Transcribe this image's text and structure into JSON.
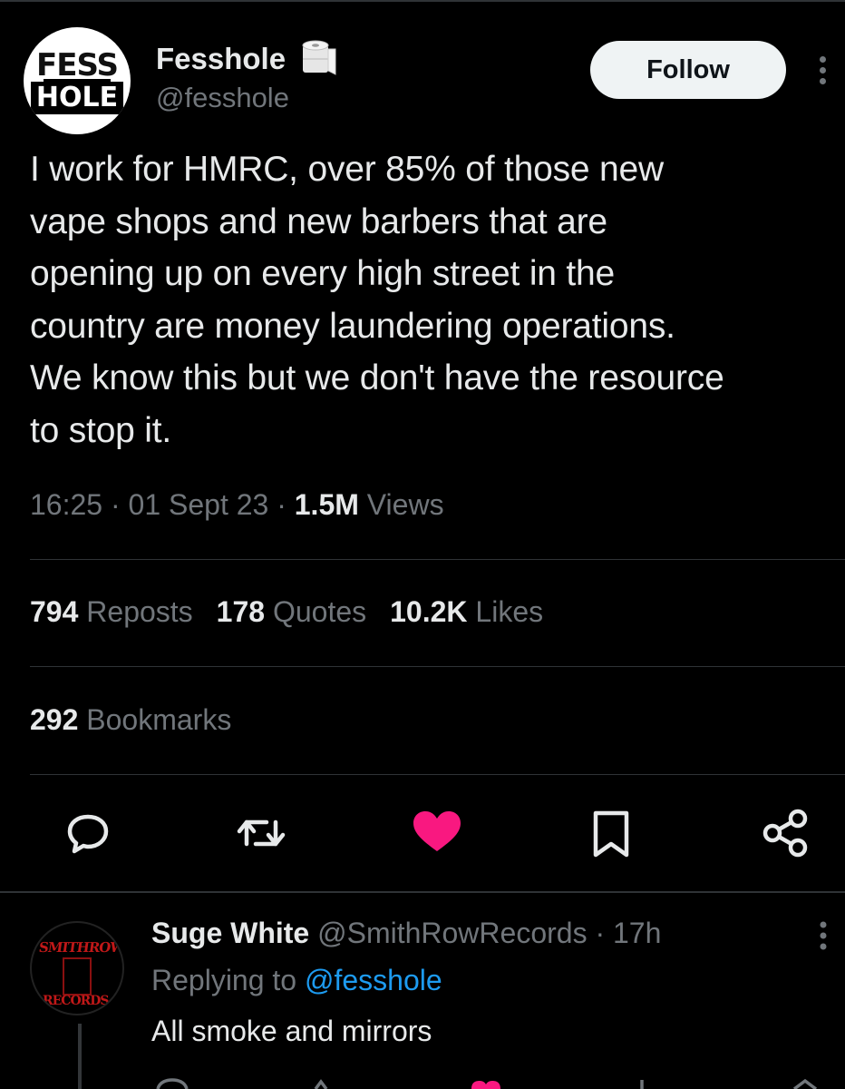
{
  "tweet": {
    "author_name": "Fesshole",
    "author_handle": "@fesshole",
    "avatar": {
      "line1": "FESS",
      "line2": "HOLE"
    },
    "badge_icon": "toilet-paper-icon",
    "follow_label": "Follow",
    "text": "I work for HMRC, over 85% of those new\nvape shops and new barbers that are\nopening up on every high street in the\ncountry are money laundering operations.\nWe know this but we don't have the resource\nto stop it.",
    "time": "16:25",
    "date": "01 Sept 23",
    "views_count": "1.5M",
    "views_label": "Views",
    "stats": {
      "reposts_count": "794",
      "reposts_label": "Reposts",
      "quotes_count": "178",
      "quotes_label": "Quotes",
      "likes_count": "10.2K",
      "likes_label": "Likes",
      "bookmarks_count": "292",
      "bookmarks_label": "Bookmarks"
    },
    "actions": [
      "reply-icon",
      "repost-icon",
      "like-icon",
      "bookmark-icon",
      "share-icon"
    ],
    "like_color": "#f91880"
  },
  "reply": {
    "author_name": "Suge White",
    "author_handle": "@SmithRowRecords",
    "time": "17h",
    "avatar": {
      "line1": "SMITHROWE",
      "line2": "RECORDS"
    },
    "replying_prefix": "Replying to",
    "replying_handle": "@fesshole",
    "text": "All smoke and mirrors"
  },
  "colors": {
    "background": "#000000",
    "text": "#e7e9ea",
    "muted": "#71767b",
    "link": "#1d9bf0",
    "divider": "#2f3336"
  }
}
